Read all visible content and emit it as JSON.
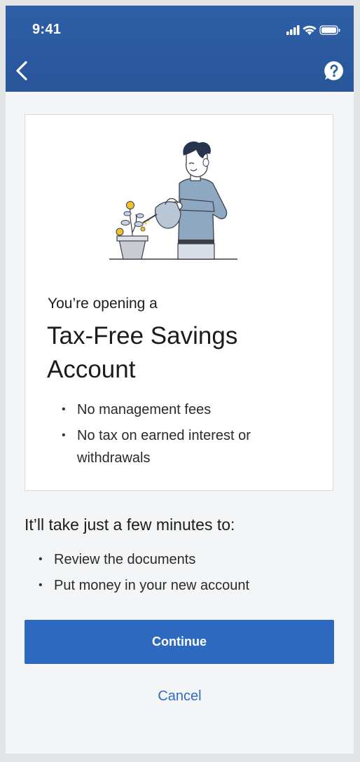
{
  "status_bar": {
    "time": "9:41"
  },
  "header": {
    "back_icon": "chevron-left-icon",
    "help_icon": "question-bubble-icon"
  },
  "card": {
    "intro": "You’re opening a",
    "title": "Tax-Free Savings Account",
    "bullets": [
      "No management fees",
      "No tax on earned interest or withdrawals"
    ]
  },
  "steps": {
    "heading": "It’ll take just a few minutes to:",
    "items": [
      "Review the documents",
      "Put money in your new account"
    ]
  },
  "actions": {
    "continue_label": "Continue",
    "cancel_label": "Cancel"
  },
  "colors": {
    "header_blue": "#2d5fa7",
    "primary_button": "#2e69c0",
    "link_blue": "#2e6bc6"
  }
}
